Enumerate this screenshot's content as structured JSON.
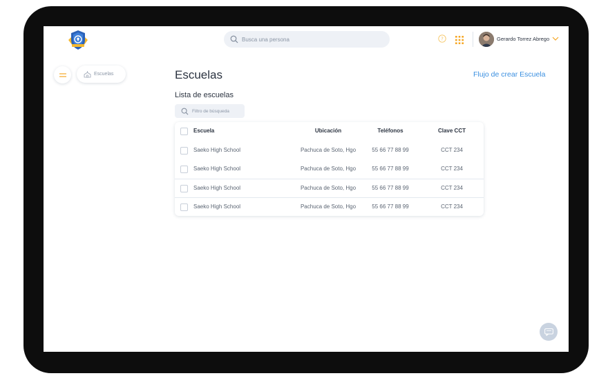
{
  "header": {
    "search_placeholder": "Busca una persona",
    "user_name": "Gerardo Torrez Abrego"
  },
  "sidebar": {
    "breadcrumb_label": "Escuelas"
  },
  "main": {
    "title": "Escuelas",
    "flow_link": "Flujo de crear Escuela",
    "section_title": "Lista de escuelas",
    "filter_placeholder": "Filtro de búsqueda",
    "table": {
      "columns": [
        "Escuela",
        "Ubicación",
        "Teléfonos",
        "Clave CCT"
      ],
      "rows": [
        [
          "Saeko High School",
          "Pachuca de Soto, Hgo",
          "55 66 77 88 99",
          "CCT 234"
        ],
        [
          "Saeko High School",
          "Pachuca de Soto, Hgo",
          "55 66 77 88 99",
          "CCT 234"
        ],
        [
          "Saeko High School",
          "Pachuca de Soto, Hgo",
          "55 66 77 88 99",
          "CCT 234"
        ],
        [
          "Saeko High School",
          "Pachuca de Soto, Hgo",
          "55 66 77 88 99",
          "CCT 234"
        ]
      ]
    }
  },
  "icons": [
    "logo-shield-icon",
    "search-icon",
    "help-icon",
    "apps-grid-icon",
    "chevron-down-icon",
    "menu-icon",
    "school-icon",
    "chat-icon"
  ],
  "colors": {
    "accent": "#3a8fe0",
    "menu_orange": "#f5a623",
    "grid_orange": "#f5a623",
    "frame": "#0d0d0d"
  }
}
